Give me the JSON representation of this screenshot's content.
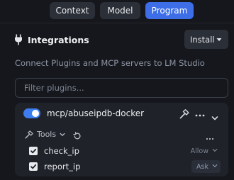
{
  "tabs": [
    {
      "label": "Context",
      "active": false
    },
    {
      "label": "Model",
      "active": false
    },
    {
      "label": "Program",
      "active": true
    }
  ],
  "integrations": {
    "title": "Integrations",
    "install_label": "Install",
    "description": "Connect Plugins and MCP servers to LM Studio",
    "search_placeholder": "Filter plugins..."
  },
  "plugin": {
    "name": "mcp/abuseipdb-docker",
    "enabled": true,
    "tools_label": "Tools",
    "tools": [
      {
        "name": "check_ip",
        "checked": true,
        "permission": "Allow"
      },
      {
        "name": "report_ip",
        "checked": true,
        "permission": "Ask"
      }
    ]
  },
  "colors": {
    "accent": "#3d6ee8",
    "background": "#15171c",
    "card": "#1f2228"
  },
  "icons": [
    "plug-icon",
    "chevron-down-icon",
    "hammer-icon",
    "more-icon",
    "wrench-icon",
    "refresh-icon",
    "check-icon"
  ]
}
